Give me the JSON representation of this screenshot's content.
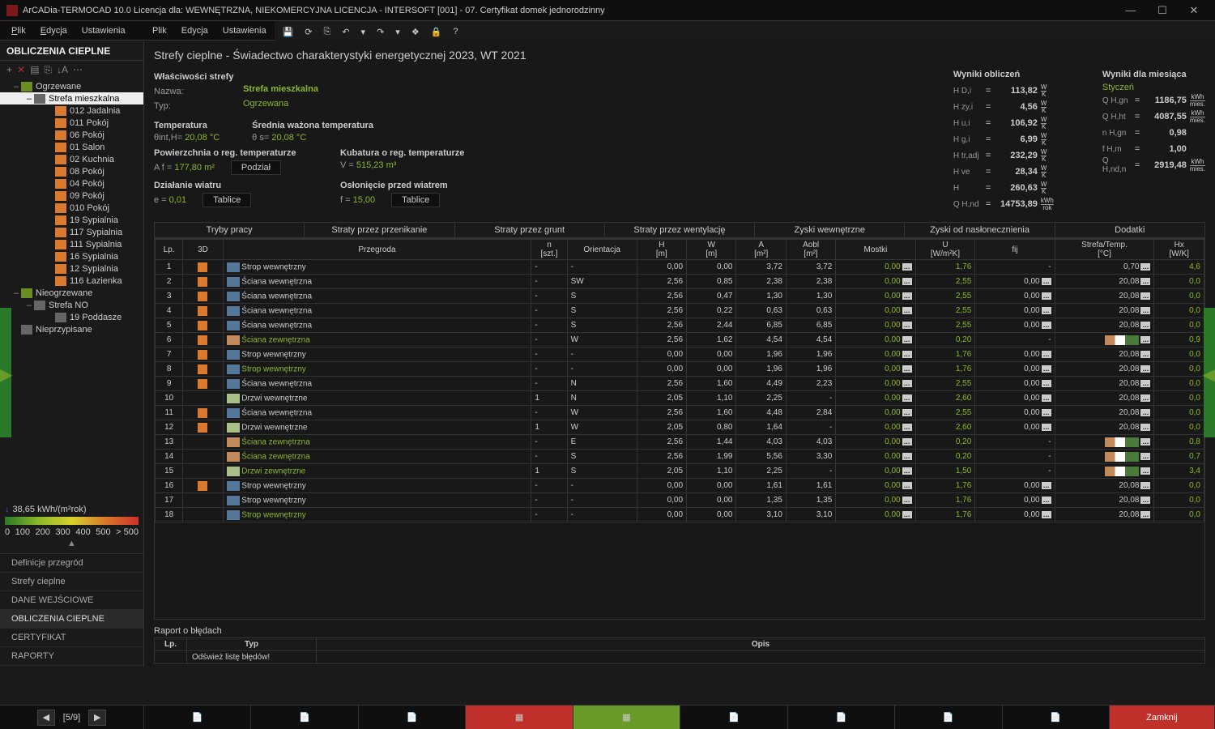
{
  "title": "ArCADia-TERMOCAD 10.0 Licencja dla: WEWNĘTRZNA, NIEKOMERCYJNA LICENCJA - INTERSOFT [001] - 07. Certyfikat domek jednorodzinny",
  "menus": {
    "plik": "Plik",
    "edycja": "Edycja",
    "ustawienia": "Ustawienia"
  },
  "sidebar": {
    "title": "OBLICZENIA CIEPLNE",
    "tree": [
      {
        "l": 0,
        "t": "Ogrzewane",
        "i": "folder",
        "e": "–"
      },
      {
        "l": 1,
        "t": "Strefa mieszkalna",
        "i": "gray",
        "sel": true,
        "e": "–"
      },
      {
        "l": 2,
        "t": "012 Jadalnia",
        "i": "orange"
      },
      {
        "l": 2,
        "t": "011 Pokój",
        "i": "orange"
      },
      {
        "l": 2,
        "t": "06 Pokój",
        "i": "orange"
      },
      {
        "l": 2,
        "t": "01 Salon",
        "i": "orange"
      },
      {
        "l": 2,
        "t": "02 Kuchnia",
        "i": "orange"
      },
      {
        "l": 2,
        "t": "08 Pokój",
        "i": "orange"
      },
      {
        "l": 2,
        "t": "04 Pokój",
        "i": "orange"
      },
      {
        "l": 2,
        "t": "09 Pokój",
        "i": "orange"
      },
      {
        "l": 2,
        "t": "010 Pokój",
        "i": "orange"
      },
      {
        "l": 2,
        "t": "19 Sypialnia",
        "i": "orange"
      },
      {
        "l": 2,
        "t": "117 Sypialnia",
        "i": "orange"
      },
      {
        "l": 2,
        "t": "111 Sypialnia",
        "i": "orange"
      },
      {
        "l": 2,
        "t": "16 Sypialnia",
        "i": "orange"
      },
      {
        "l": 2,
        "t": "12 Sypialnia",
        "i": "orange"
      },
      {
        "l": 2,
        "t": "116 Łazienka",
        "i": "orange"
      },
      {
        "l": 0,
        "t": "Nieogrzewane",
        "i": "folder",
        "e": "–"
      },
      {
        "l": 1,
        "t": "Strefa NO",
        "i": "gray",
        "e": "–"
      },
      {
        "l": 2,
        "t": "19 Poddasze",
        "i": "gray"
      },
      {
        "l": 0,
        "t": "Nieprzypisane",
        "i": "gray"
      }
    ],
    "meter": {
      "value": "38,65 kWh/(m²rok)",
      "ticks": [
        "0",
        "100",
        "200",
        "300",
        "400",
        "500",
        "> 500"
      ]
    },
    "nav": [
      "Definicje przegród",
      "Strefy cieplne",
      "DANE WEJŚCIOWE",
      "OBLICZENIA CIEPLNE",
      "CERTYFIKAT",
      "RAPORTY"
    ]
  },
  "header": "Strefy cieplne - Świadectwo charakterystyki energetycznej 2023, WT 2021",
  "props": {
    "sect": "Właściwości strefy",
    "name_l": "Nazwa:",
    "name_v": "Strefa mieszkalna",
    "type_l": "Typ:",
    "type_v": "Ogrzewana",
    "temp_l": "Temperatura",
    "temp_s": "θint,H=",
    "temp_v": "20,08 °C",
    "avg_l": "Średnia ważona temperatura",
    "avg_s": "θ s=",
    "avg_v": "20,08 °C",
    "area_l": "Powierzchnia o reg. temperaturze",
    "area_s": "A f =",
    "area_v": "177,80 m²",
    "podzial": "Podział",
    "vol_l": "Kubatura o reg. temperaturze",
    "vol_s": "V =",
    "vol_v": "515,23 m³",
    "wind_l": "Działanie wiatru",
    "wind_s": "e =",
    "wind_v": "0,01",
    "tablice": "Tablice",
    "shld_l": "Osłonięcie przed wiatrem",
    "shld_s": "f =",
    "shld_v": "15,00"
  },
  "results": {
    "h1": "Wyniki obliczeń",
    "rows1": [
      {
        "s": "H D,i",
        "v": "113,82",
        "u": "W/K"
      },
      {
        "s": "H zy,i",
        "v": "4,56",
        "u": "W/K"
      },
      {
        "s": "H u,i",
        "v": "106,92",
        "u": "W/K"
      },
      {
        "s": "H g,i",
        "v": "6,99",
        "u": "W/K"
      },
      {
        "s": "H tr,adj",
        "v": "232,29",
        "u": "W/K"
      },
      {
        "s": "H ve",
        "v": "28,34",
        "u": "W/K"
      },
      {
        "s": "H",
        "v": "260,63",
        "u": "W/K"
      },
      {
        "s": "Q H,nd",
        "v": "14753,89",
        "u": "kWh/rok"
      }
    ],
    "h2": "Wyniki dla miesiąca",
    "month": "Styczeń",
    "rows2": [
      {
        "s": "Q H,gn",
        "v": "1186,75",
        "u": "kWh/mies."
      },
      {
        "s": "Q H,ht",
        "v": "4087,55",
        "u": "kWh/mies."
      },
      {
        "s": "n H,gn",
        "v": "0,98",
        "u": ""
      },
      {
        "s": "f H,m",
        "v": "1,00",
        "u": ""
      },
      {
        "s": "Q H,nd,n",
        "v": "2919,48",
        "u": "kWh/mies."
      }
    ]
  },
  "tabs": [
    "Tryby pracy",
    "Straty przez przenikanie",
    "Straty przez grunt",
    "Straty przez wentylację",
    "Zyski wewnętrzne",
    "Zyski od nasłonecznienia",
    "Dodatki"
  ],
  "cols": [
    "Lp.",
    "3D",
    "Przegroda",
    "n [szt.]",
    "Orientacja",
    "H [m]",
    "W [m]",
    "A [m²]",
    "Aobl [m²]",
    "Mostki",
    "U [W/m²K]",
    "fij",
    "Strefa/Temp. [°C]",
    "Hx [W/K]"
  ],
  "rows": [
    {
      "lp": 1,
      "i": "blue",
      "p": "Strop wewnętrzny",
      "n": "-",
      "o": "-",
      "h": "0,00",
      "w": "0,00",
      "a": "3,72",
      "ao": "3,72",
      "m": "0,00",
      "u": "1,76",
      "f": "-",
      "t": "0,70",
      "hx": "4,6"
    },
    {
      "lp": 2,
      "i": "blue",
      "p": "Ściana wewnętrzna",
      "n": "-",
      "o": "SW",
      "h": "2,56",
      "w": "0,85",
      "a": "2,38",
      "ao": "2,38",
      "m": "0,00",
      "u": "2,55",
      "f": "0,00",
      "t": "20,08",
      "hx": "0,0"
    },
    {
      "lp": 3,
      "i": "blue",
      "p": "Ściana wewnętrzna",
      "n": "-",
      "o": "S",
      "h": "2,56",
      "w": "0,47",
      "a": "1,30",
      "ao": "1,30",
      "m": "0,00",
      "u": "2,55",
      "f": "0,00",
      "t": "20,08",
      "hx": "0,0"
    },
    {
      "lp": 4,
      "i": "blue",
      "p": "Ściana wewnętrzna",
      "n": "-",
      "o": "S",
      "h": "2,56",
      "w": "0,22",
      "a": "0,63",
      "ao": "0,63",
      "m": "0,00",
      "u": "2,55",
      "f": "0,00",
      "t": "20,08",
      "hx": "0,0"
    },
    {
      "lp": 5,
      "i": "blue",
      "p": "Ściana wewnętrzna",
      "n": "-",
      "o": "S",
      "h": "2,56",
      "w": "2,44",
      "a": "6,85",
      "ao": "6,85",
      "m": "0,00",
      "u": "2,55",
      "f": "0,00",
      "t": "20,08",
      "hx": "0,0"
    },
    {
      "lp": 6,
      "i": "brick",
      "p": "Ściana zewnętrzna",
      "g": 1,
      "n": "-",
      "o": "W",
      "h": "2,56",
      "w": "1,62",
      "a": "4,54",
      "ao": "4,54",
      "m": "0,00",
      "u": "0,20",
      "f": "-",
      "ti": 1,
      "hx": "0,9"
    },
    {
      "lp": 7,
      "i": "blue",
      "p": "Strop wewnętrzny",
      "n": "-",
      "o": "-",
      "h": "0,00",
      "w": "0,00",
      "a": "1,96",
      "ao": "1,96",
      "m": "0,00",
      "u": "1,76",
      "f": "0,00",
      "t": "20,08",
      "hx": "0,0"
    },
    {
      "lp": 8,
      "i": "blue",
      "p": "Strop wewnętrzny",
      "g": 1,
      "n": "-",
      "o": "-",
      "h": "0,00",
      "w": "0,00",
      "a": "1,96",
      "ao": "1,96",
      "m": "0,00",
      "u": "1,76",
      "f": "0,00",
      "t": "20,08",
      "hx": "0,0"
    },
    {
      "lp": 9,
      "i": "blue",
      "p": "Ściana wewnętrzna",
      "n": "-",
      "o": "N",
      "h": "2,56",
      "w": "1,60",
      "a": "4,49",
      "ao": "2,23",
      "m": "0,00",
      "u": "2,55",
      "f": "0,00",
      "t": "20,08",
      "hx": "0,0"
    },
    {
      "lp": 10,
      "i": "door",
      "p": "Drzwi wewnętrzne",
      "n": "1",
      "o": "N",
      "h": "2,05",
      "w": "1,10",
      "a": "2,25",
      "ao": "-",
      "m": "0,00",
      "u": "2,60",
      "f": "0,00",
      "t": "20,08",
      "hx": "0,0",
      "noic": 1
    },
    {
      "lp": 11,
      "i": "blue",
      "p": "Ściana wewnętrzna",
      "n": "-",
      "o": "W",
      "h": "2,56",
      "w": "1,60",
      "a": "4,48",
      "ao": "2,84",
      "m": "0,00",
      "u": "2,55",
      "f": "0,00",
      "t": "20,08",
      "hx": "0,0"
    },
    {
      "lp": 12,
      "i": "door",
      "p": "Drzwi wewnętrzne",
      "n": "1",
      "o": "W",
      "h": "2,05",
      "w": "0,80",
      "a": "1,64",
      "ao": "-",
      "m": "0,00",
      "u": "2,60",
      "f": "0,00",
      "t": "20,08",
      "hx": "0,0"
    },
    {
      "lp": 13,
      "i": "brick",
      "p": "Ściana zewnętrzna",
      "g": 1,
      "n": "-",
      "o": "E",
      "h": "2,56",
      "w": "1,44",
      "a": "4,03",
      "ao": "4,03",
      "m": "0,00",
      "u": "0,20",
      "f": "-",
      "ti": 1,
      "hx": "0,8",
      "noic": 1
    },
    {
      "lp": 14,
      "i": "brick",
      "p": "Ściana zewnętrzna",
      "g": 1,
      "n": "-",
      "o": "S",
      "h": "2,56",
      "w": "1,99",
      "a": "5,56",
      "ao": "3,30",
      "m": "0,00",
      "u": "0,20",
      "f": "-",
      "ti": 1,
      "hx": "0,7",
      "noic": 1
    },
    {
      "lp": 15,
      "i": "door",
      "p": "Drzwi zewnętrzne",
      "g": 1,
      "n": "1",
      "o": "S",
      "h": "2,05",
      "w": "1,10",
      "a": "2,25",
      "ao": "-",
      "m": "0,00",
      "u": "1,50",
      "f": "-",
      "ti": 1,
      "hx": "3,4",
      "noic": 1
    },
    {
      "lp": 16,
      "i": "blue",
      "p": "Strop wewnętrzny",
      "n": "-",
      "o": "-",
      "h": "0,00",
      "w": "0,00",
      "a": "1,61",
      "ao": "1,61",
      "m": "0,00",
      "u": "1,76",
      "f": "0,00",
      "t": "20,08",
      "hx": "0,0"
    },
    {
      "lp": 17,
      "i": "blue",
      "p": "Strop wewnętrzny",
      "n": "-",
      "o": "-",
      "h": "0,00",
      "w": "0,00",
      "a": "1,35",
      "ao": "1,35",
      "m": "0,00",
      "u": "1,76",
      "f": "0,00",
      "t": "20,08",
      "hx": "0,0",
      "noic": 1
    },
    {
      "lp": 18,
      "i": "blue",
      "p": "Strop wewnętrzny",
      "g": 1,
      "n": "-",
      "o": "-",
      "h": "0,00",
      "w": "0,00",
      "a": "3,10",
      "ao": "3,10",
      "m": "0,00",
      "u": "1,76",
      "f": "0,00",
      "t": "20,08",
      "hx": "0,0",
      "noic": 1
    }
  ],
  "errors": {
    "title": "Raport o błędach",
    "cols": [
      "Lp.",
      "Typ",
      "Opis"
    ],
    "msg": "Odśwież listę błędów!"
  },
  "footer": {
    "page": "[5/9]",
    "close": "Zamknij"
  }
}
